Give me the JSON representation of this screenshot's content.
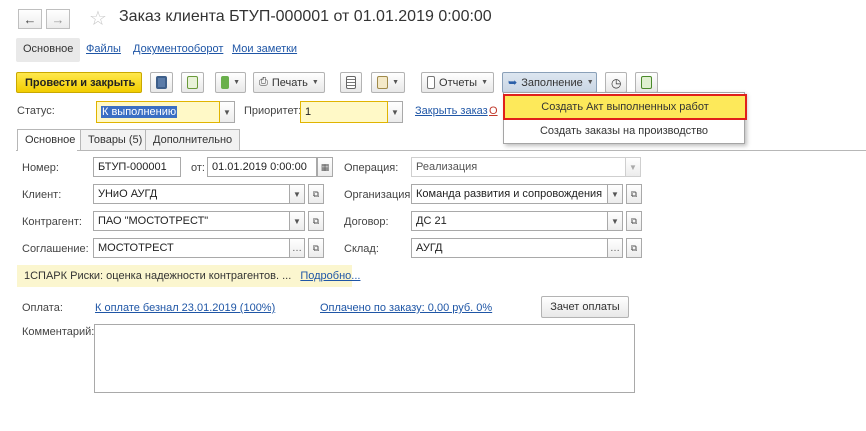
{
  "header": {
    "back_icon": "arrow-left-icon",
    "forward_icon": "arrow-right-icon",
    "favorite_icon": "star-icon",
    "title": "Заказ клиента БТУП-000001 от 01.01.2019 0:00:00"
  },
  "sections": [
    "Основное",
    "Файлы",
    "Документооборот",
    "Мои заметки"
  ],
  "toolbar": {
    "post_close": "Провести и закрыть",
    "print": "Печать",
    "reports": "Отчеты",
    "fill": "Заполнение"
  },
  "fill_menu": {
    "items": [
      "Создать Акт выполненных работ",
      "Создать заказы на производство"
    ],
    "highlight_color": "#e0201b"
  },
  "status_row": {
    "status_label": "Статус:",
    "status_value": "К выполнению",
    "priority_label": "Приоритет:",
    "priority_value": "1",
    "close_order_link": "Закрыть заказ",
    "truncated_link": "О"
  },
  "tabs": [
    "Основное",
    "Товары (5)",
    "Дополнительно"
  ],
  "form": {
    "number_label": "Номер:",
    "number_value": "БТУП-000001",
    "from_label": "от:",
    "date_value": "01.01.2019  0:00:00",
    "operation_label": "Операция:",
    "operation_value": "Реализация",
    "client_label": "Клиент:",
    "client_value": "УНиО АУГД",
    "organization_label": "Организация:",
    "organization_value": "Команда развития и сопровождения",
    "counterparty_label": "Контрагент:",
    "counterparty_value": "ПАО \"МОСТОТРЕСТ\"",
    "contract_label": "Договор:",
    "contract_value": "ДС 21",
    "agreement_label": "Соглашение:",
    "agreement_value": "МОСТОТРЕСТ",
    "warehouse_label": "Склад:",
    "warehouse_value": "АУГД"
  },
  "spark": {
    "text": "1СПАРК Риски: оценка надежности контрагентов. ...",
    "more_link": "Подробно..."
  },
  "payment": {
    "label": "Оплата:",
    "due_link": "К оплате безнал 23.01.2019 (100%)",
    "paid_link": "Оплачено по заказу: 0,00 руб.  0%",
    "offset_button": "Зачет оплаты"
  },
  "comment": {
    "label": "Комментарий:"
  }
}
